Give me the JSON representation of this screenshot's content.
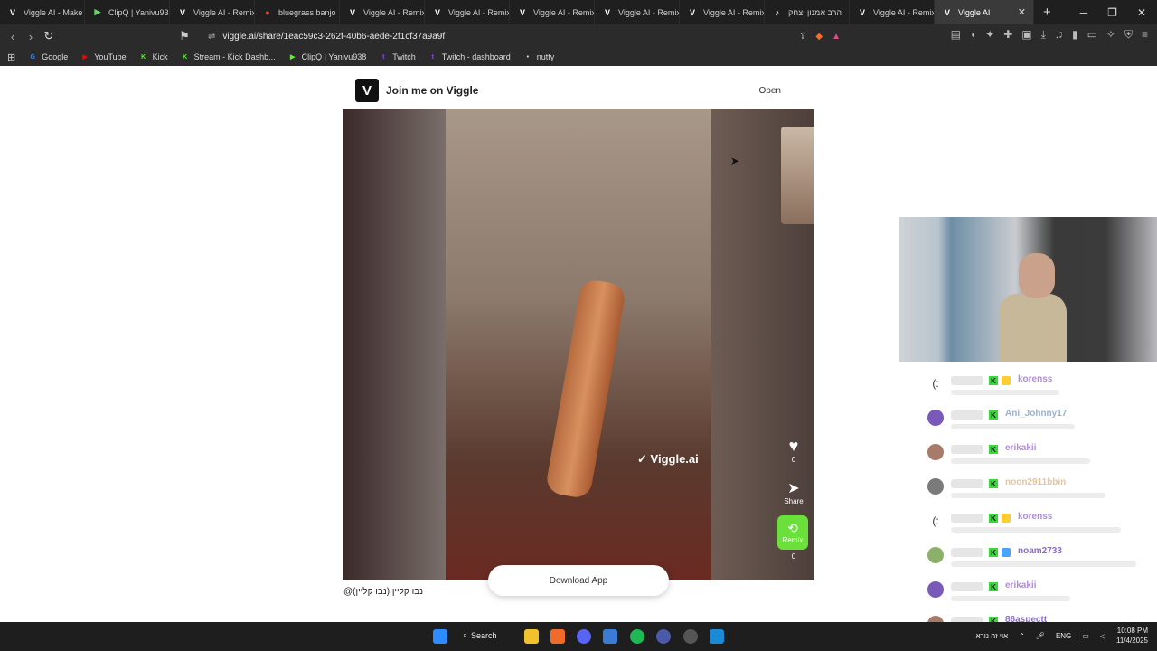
{
  "tabs": [
    {
      "label": "Viggle AI - Make",
      "icon": "V",
      "color": "#ffffff"
    },
    {
      "label": "ClipQ | Yanivu938",
      "icon": "▶",
      "color": "#5bdc5b"
    },
    {
      "label": "Viggle AI - Remix",
      "icon": "V",
      "color": "#ffffff"
    },
    {
      "label": "bluegrass banjo",
      "icon": "●",
      "color": "#ff3b3b"
    },
    {
      "label": "Viggle AI - Remix",
      "icon": "V",
      "color": "#ffffff"
    },
    {
      "label": "Viggle AI - Remix",
      "icon": "V",
      "color": "#ffffff"
    },
    {
      "label": "Viggle AI - Remix",
      "icon": "V",
      "color": "#ffffff"
    },
    {
      "label": "Viggle AI - Remix",
      "icon": "V",
      "color": "#ffffff"
    },
    {
      "label": "Viggle AI - Remix",
      "icon": "V",
      "color": "#ffffff"
    },
    {
      "label": "הרב אמנון יצחק",
      "icon": "♪",
      "color": "#ffffff"
    },
    {
      "label": "Viggle AI - Remix",
      "icon": "V",
      "color": "#ffffff"
    },
    {
      "label": "Viggle AI",
      "icon": "V",
      "color": "#ffffff",
      "active": true
    }
  ],
  "address": {
    "url": "viggle.ai/share/1eac59c3-262f-40b6-aede-2f1cf37a9a9f"
  },
  "bookmarks": [
    {
      "label": "Google",
      "icon": "G",
      "color": "#4285f4"
    },
    {
      "label": "YouTube",
      "icon": "▶",
      "color": "#ff0000"
    },
    {
      "label": "Kick",
      "icon": "K",
      "color": "#53fc18"
    },
    {
      "label": "Stream - Kick Dashb...",
      "icon": "K",
      "color": "#53fc18"
    },
    {
      "label": "ClipQ | Yanivu938",
      "icon": "▶",
      "color": "#53fc18"
    },
    {
      "label": "Twitch",
      "icon": "t",
      "color": "#9146ff"
    },
    {
      "label": "Twitch - dashboard",
      "icon": "t",
      "color": "#9146ff"
    },
    {
      "label": "nutty",
      "icon": "•",
      "color": "#dddddd"
    }
  ],
  "viggle": {
    "banner_text": "Join me on Viggle",
    "open_label": "Open",
    "watermark": "Viggle.ai",
    "like_count": "0",
    "share_label": "Share",
    "remix_label": "Remix",
    "remix_count": "0",
    "download_label": "Download App",
    "caption": "@נבו קליין (נבו קליין)"
  },
  "chat": [
    {
      "user": "korenss",
      "color": "#b08be0",
      "avatar": "(:",
      "badge2": "#ffcc33"
    },
    {
      "user": "Ani_Johnny17",
      "color": "#9bb0d0",
      "avatar": "",
      "badge2": ""
    },
    {
      "user": "erikakii",
      "color": "#b08be0",
      "avatar": "",
      "badge2": ""
    },
    {
      "user": "noon2911bbin",
      "color": "#e6c59a",
      "avatar": "",
      "badge2": ""
    },
    {
      "user": "korenss",
      "color": "#b08be0",
      "avatar": "(:",
      "badge2": "#ffcc33"
    },
    {
      "user": "noam2733",
      "color": "#8a6ccf",
      "avatar": "",
      "badge2": "#4aa3ff"
    },
    {
      "user": "erikakii",
      "color": "#b08be0",
      "avatar": "",
      "badge2": ""
    },
    {
      "user": "86aspectt",
      "color": "#8a6ccf",
      "avatar": "",
      "badge2": ""
    }
  ],
  "taskbar": {
    "search_label": "Search",
    "ime_text": "אוי זה נורא",
    "lang": "ENG",
    "time": "10:08 PM",
    "date": "11/4/2025"
  }
}
